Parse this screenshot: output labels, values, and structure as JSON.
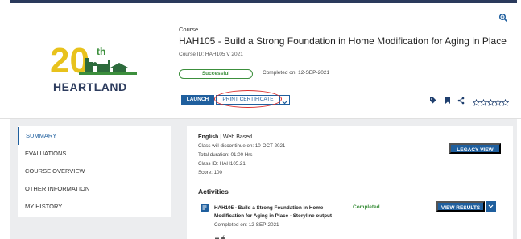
{
  "header": {
    "kicker": "Course",
    "title": "HAH105 - Build a Strong Foundation in Home Modification for Aging in Place",
    "course_id": "Course ID: HAH105 V 2021",
    "status": "Successful",
    "completed_on": "Completed on: 12-SEP-2021"
  },
  "logo": {
    "text": "HEARTLAND",
    "number": "20",
    "suffix": "th"
  },
  "actions": {
    "launch": "LAUNCH",
    "print_certificate": "PRINT CERTIFICATE"
  },
  "icons": [
    "zoom-icon",
    "tag-icon",
    "bookmark-icon",
    "share-icon",
    "star-icon"
  ],
  "rating": {
    "stars_total": 5,
    "stars_filled": 0
  },
  "sidebar": {
    "items": [
      {
        "label": "SUMMARY",
        "active": true
      },
      {
        "label": "EVALUATIONS",
        "active": false
      },
      {
        "label": "COURSE OVERVIEW",
        "active": false
      },
      {
        "label": "OTHER INFORMATION",
        "active": false
      },
      {
        "label": "MY HISTORY",
        "active": false
      }
    ]
  },
  "summary": {
    "language": "English",
    "separator": "|",
    "delivery": "Web Based",
    "discontinue": "Class will discontinue on: 10-OCT-2021",
    "duration": "Total duration: 01:00 Hrs",
    "class_id": "Class ID: HAH105.21",
    "score": "Score: 100",
    "legacy_view": "LEGACY VIEW"
  },
  "activities": {
    "heading": "Activities",
    "items": [
      {
        "title": "HAH105 - Build a Strong Foundation in Home Modification for Aging in Place - Storyline output",
        "status": "Completed",
        "completed_on": "Completed on: 12-SEP-2021",
        "button": "VIEW RESULTS"
      }
    ]
  },
  "colors": {
    "primary": "#1f5f9e",
    "success": "#3c8f3c",
    "highlight": "#d93030",
    "topbar": "#2a3a5c",
    "band": "#ecedef"
  }
}
